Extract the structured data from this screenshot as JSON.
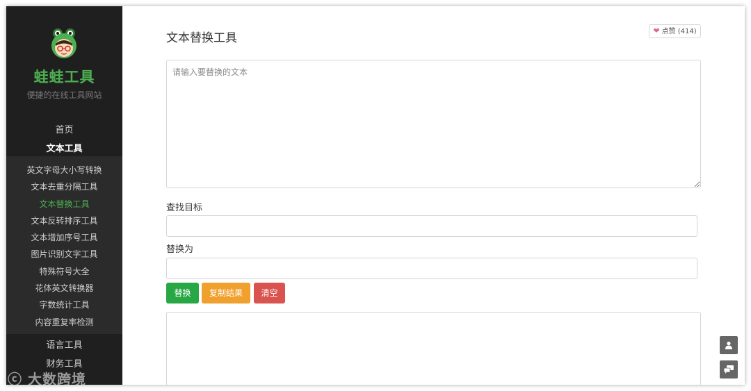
{
  "sidebar": {
    "brand": "蛙蛙工具",
    "slogan": "便捷的在线工具网站",
    "nav_home": "首页",
    "nav_text_tools": "文本工具",
    "submenu": [
      {
        "label": "英文字母大小写转换"
      },
      {
        "label": "文本去重分隔工具"
      },
      {
        "label": "文本替换工具"
      },
      {
        "label": "文本反转排序工具"
      },
      {
        "label": "文本增加序号工具"
      },
      {
        "label": "图片识别文字工具"
      },
      {
        "label": "特殊符号大全"
      },
      {
        "label": "花体英文转换器"
      },
      {
        "label": "字数统计工具"
      },
      {
        "label": "内容重复率检测"
      }
    ],
    "active_item": "文本替换工具",
    "nav_language_tools": "语言工具",
    "nav_finance_tools": "财务工具"
  },
  "main": {
    "title": "文本替换工具",
    "like_label": "点赞 (414)",
    "input_placeholder": "请输入要替换的文本",
    "find_label": "查找目标",
    "replace_label": "替换为",
    "buttons": {
      "replace": "替换",
      "copy": "复制结果",
      "clear": "清空"
    }
  },
  "icons": {
    "like": "heart-icon",
    "user": "user-icon",
    "chat": "chat-icon",
    "logo": "frog-logo-icon"
  },
  "colors": {
    "brand_green": "#4caf50",
    "replace_button": "#28a745",
    "copy_button": "#f0a02c",
    "clear_button": "#d9534f",
    "sidebar_bg": "#1f1f1f"
  },
  "watermark": "大数跨境"
}
